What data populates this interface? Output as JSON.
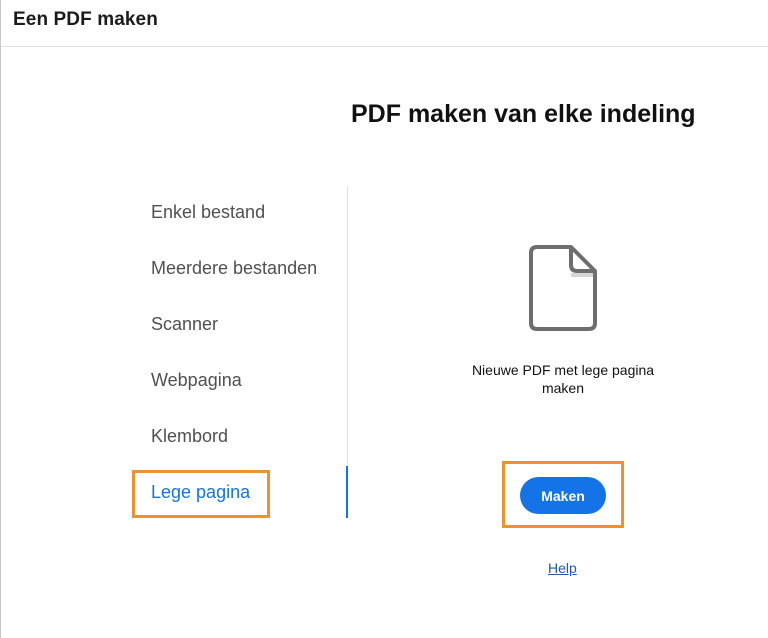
{
  "window": {
    "title": "Een PDF maken"
  },
  "main": {
    "heading": "PDF maken van elke indeling",
    "description": "Nieuwe PDF met lege pagina maken",
    "make_button": "Maken",
    "help_link": "Help"
  },
  "sidebar": {
    "items": [
      {
        "label": "Enkel bestand"
      },
      {
        "label": "Meerdere bestanden"
      },
      {
        "label": "Scanner"
      },
      {
        "label": "Webpagina"
      },
      {
        "label": "Klembord"
      },
      {
        "label": "Lege pagina",
        "selected": true
      }
    ]
  },
  "colors": {
    "accent": "#1473e6",
    "highlight": "#f0912a"
  },
  "icons": {
    "document": "blank-document-icon"
  }
}
